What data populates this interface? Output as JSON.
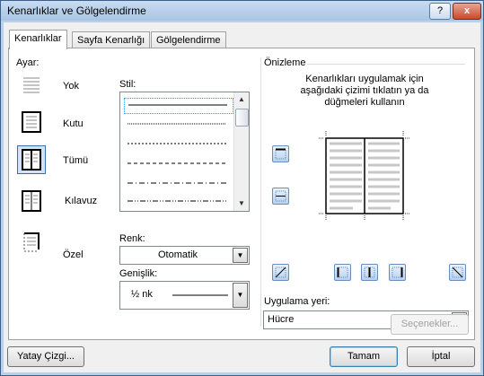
{
  "window": {
    "title": "Kenarlıklar ve Gölgelendirme",
    "help_glyph": "?",
    "close_glyph": "x"
  },
  "tabs": [
    {
      "label": "Kenarlıklar",
      "active": true
    },
    {
      "label": "Sayfa Kenarlığı",
      "active": false
    },
    {
      "label": "Gölgelendirme",
      "active": false
    }
  ],
  "setting": {
    "group_label": "Ayar:",
    "options": [
      {
        "label": "Yok",
        "selected": false
      },
      {
        "label": "Kutu",
        "selected": false
      },
      {
        "label": "Tümü",
        "selected": true
      },
      {
        "label": "Kılavuz",
        "selected": false
      },
      {
        "label": "Özel",
        "selected": false
      }
    ]
  },
  "style": {
    "label": "Stil:",
    "line_styles": [
      "solid",
      "dotted-fine",
      "dashed-small",
      "dashed",
      "dash-dot",
      "dash-dot-dot"
    ],
    "selected_index": 0,
    "scroll": {
      "up_glyph": "▲",
      "down_glyph": "▼"
    }
  },
  "color": {
    "label": "Renk:",
    "value": "Otomatik"
  },
  "width": {
    "label": "Genişlik:",
    "value": "½ nk"
  },
  "preview": {
    "label": "Önizleme",
    "instruction": "Kenarlıkları uygulamak için aşağıdaki çizimi tıklatın ya da düğmeleri kullanın"
  },
  "apply_to": {
    "label": "Uygulama yeri:",
    "value": "Hücre"
  },
  "buttons": {
    "options": "Seçenekler...",
    "horizontal_line": "Yatay Çizgi...",
    "ok": "Tamam",
    "cancel": "İptal"
  },
  "colors": {
    "accent": "#3b6fb0",
    "title_bg": "#b9d1ea",
    "close": "#c74a2e"
  }
}
